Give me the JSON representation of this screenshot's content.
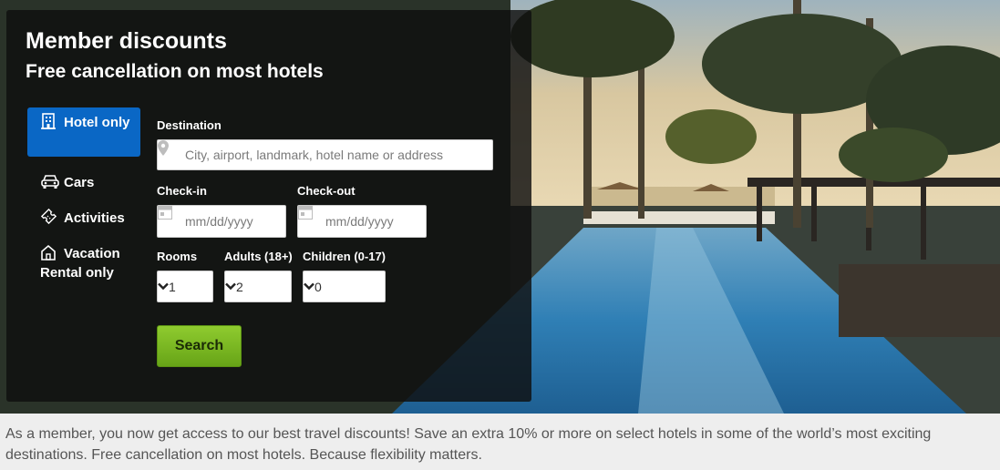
{
  "promo": {
    "title": "Member discounts",
    "subtitle": "Free cancellation on most hotels"
  },
  "tabs": [
    {
      "label": "Hotel only",
      "icon": "hotel-icon",
      "active": true
    },
    {
      "label": "Cars",
      "icon": "car-icon",
      "active": false
    },
    {
      "label": "Activities",
      "icon": "ticket-icon",
      "active": false
    },
    {
      "label": "Vacation Rental only",
      "icon": "house-icon",
      "active": false
    }
  ],
  "form": {
    "destination_label": "Destination",
    "destination_placeholder": "City, airport, landmark, hotel name or address",
    "checkin_label": "Check-in",
    "checkin_placeholder": "mm/dd/yyyy",
    "checkout_label": "Check-out",
    "checkout_placeholder": "mm/dd/yyyy",
    "rooms_label": "Rooms",
    "rooms_value": "1",
    "adults_label": "Adults (18+)",
    "adults_value": "2",
    "children_label": "Children (0-17)",
    "children_value": "0",
    "search_label": "Search"
  },
  "description": "As a member, you now get access to our best travel discounts! Save an extra 10% or more on select hotels in some of the world’s most exciting destinations. Free cancellation on most hotels. Because flexibility matters.",
  "colors": {
    "active_tab": "#0a67c5",
    "search_button": "#7ab824",
    "panel": "#0f0f0f",
    "description_text": "#555555",
    "footer_bg": "#eeeeee"
  }
}
